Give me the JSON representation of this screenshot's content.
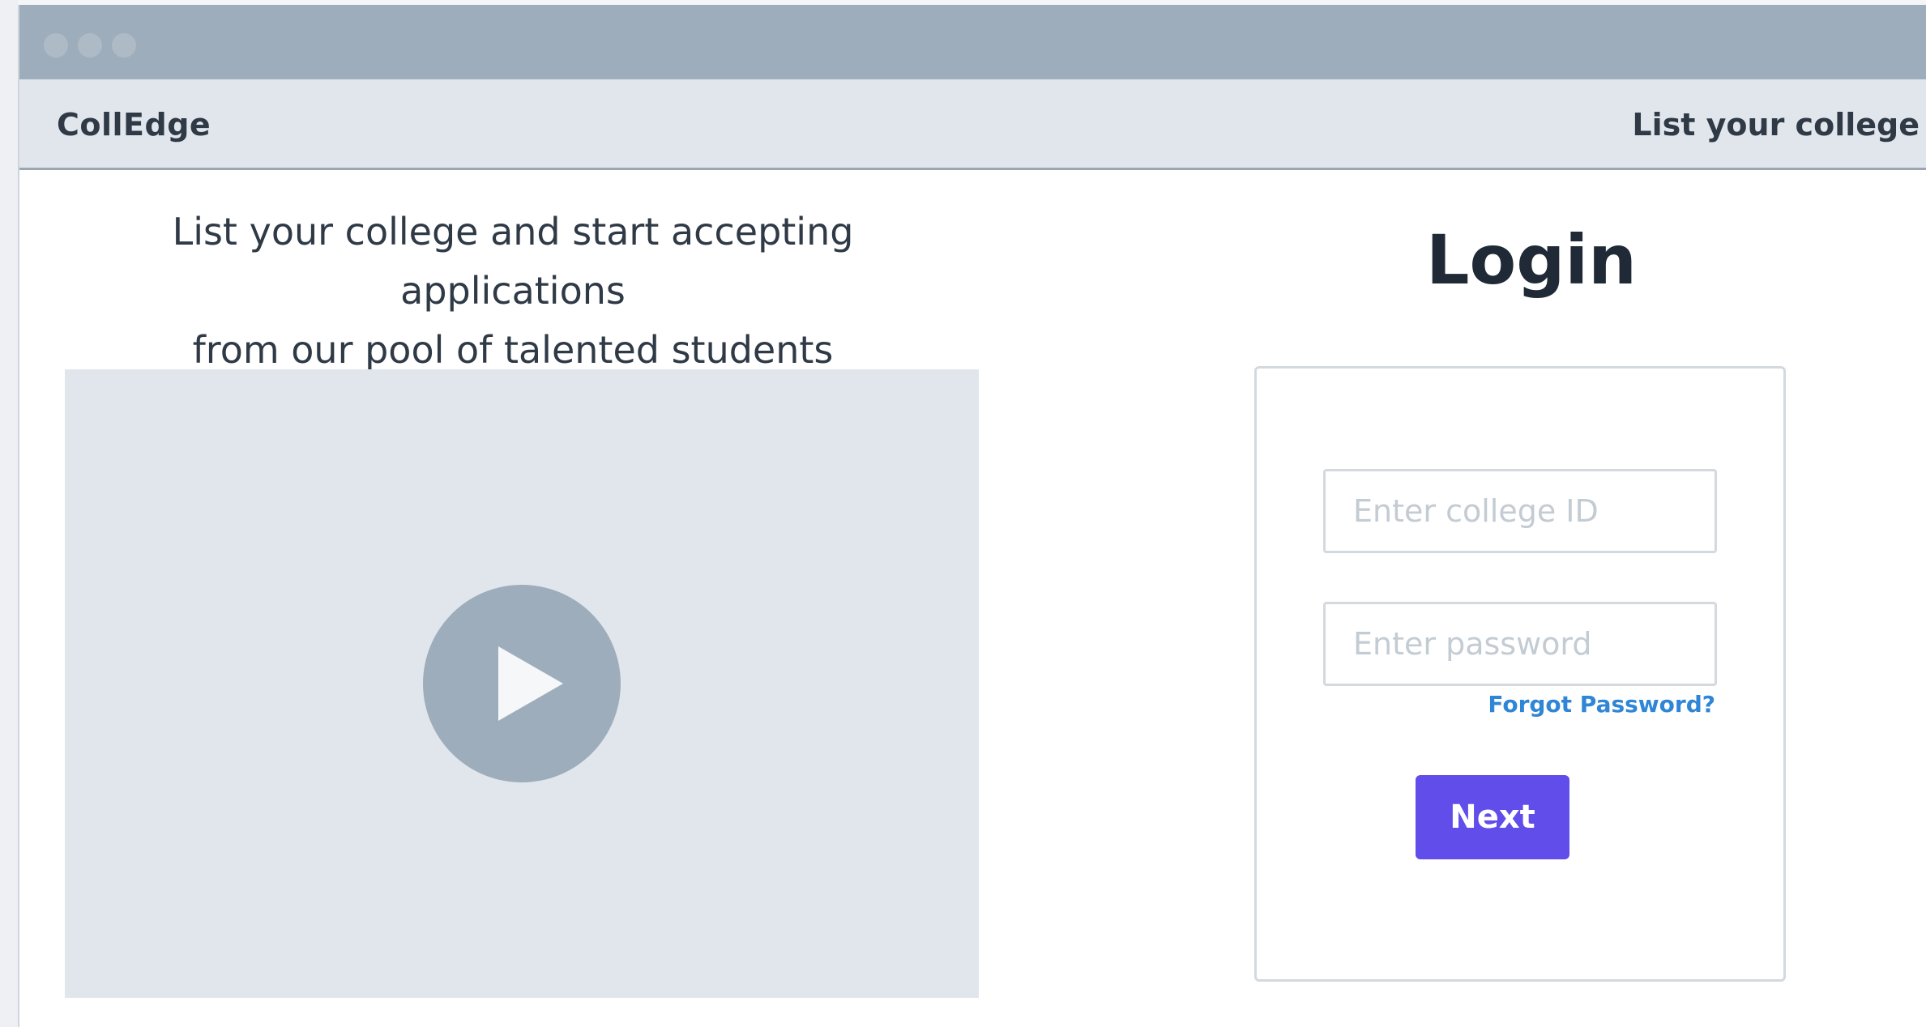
{
  "navbar": {
    "brand": "CollEdge",
    "list_link": "List your college"
  },
  "hero": {
    "line1": "List your college and start accepting applications",
    "line2": "from our pool of talented students"
  },
  "video": {
    "icon": "play-icon"
  },
  "login": {
    "title": "Login",
    "college_id_placeholder": "Enter college ID",
    "college_id_value": "",
    "password_placeholder": "Enter password",
    "password_value": "",
    "forgot_link": "Forgot Password?",
    "next_button": "Next"
  },
  "colors": {
    "titlebar": "#9eadbb",
    "navbar": "#e1e6ec",
    "accent_button": "#604dea",
    "link": "#2f86d6"
  }
}
